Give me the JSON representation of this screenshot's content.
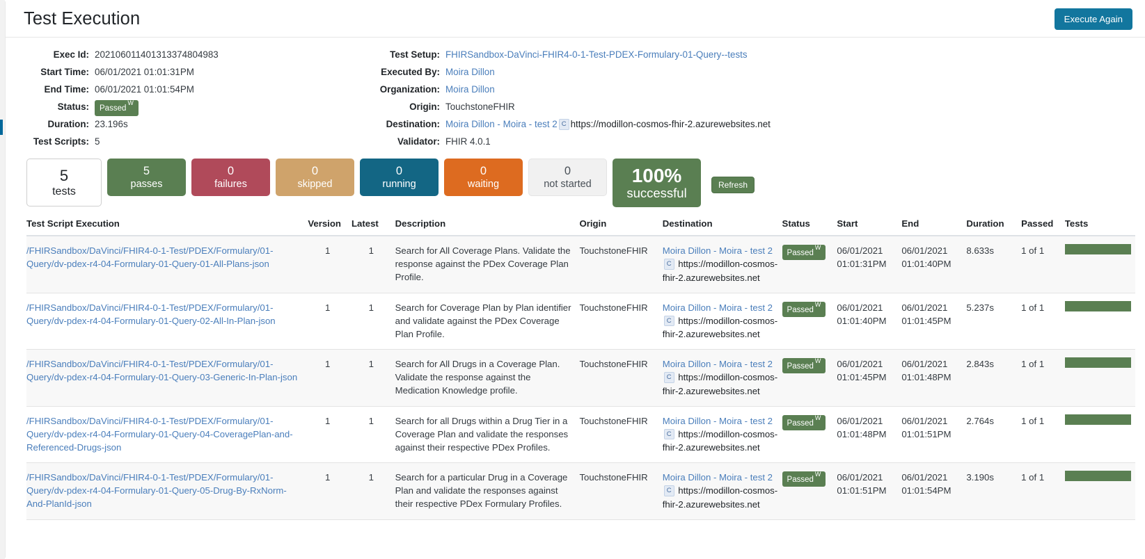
{
  "header": {
    "title": "Test Execution",
    "execute_again_label": "Execute Again"
  },
  "details": {
    "left": [
      {
        "label": "Exec Id:",
        "value": "20210601140131337480498 3"
      },
      {
        "label": "Start Time:",
        "value": "06/01/2021 01:01:31PM"
      },
      {
        "label": "End Time:",
        "value": "06/01/2021 01:01:54PM"
      },
      {
        "label": "Status:",
        "value": "Passed",
        "sup": "W"
      },
      {
        "label": "Duration:",
        "value": "23.196s"
      },
      {
        "label": "Test Scripts:",
        "value": "5"
      }
    ],
    "exec_id": "20210601140131337480498 3",
    "exec_id_text": "202106011401313374804983",
    "start_time": "06/01/2021 01:01:31PM",
    "end_time": "06/01/2021 01:01:54PM",
    "status_label": "Passed",
    "status_sup": "W",
    "duration": "23.196s",
    "test_scripts": "5",
    "labels": {
      "exec_id": "Exec Id:",
      "start_time": "Start Time:",
      "end_time": "End Time:",
      "status": "Status:",
      "duration": "Duration:",
      "test_scripts": "Test Scripts:",
      "test_setup": "Test Setup:",
      "executed_by": "Executed By:",
      "organization": "Organization:",
      "origin": "Origin:",
      "destination": "Destination:",
      "validator": "Validator:"
    },
    "test_setup": "FHIRSandbox-DaVinci-FHIR4-0-1-Test-PDEX-Formulary-01-Query--tests",
    "executed_by": "Moira Dillon",
    "organization": "Moira Dillon",
    "origin": "TouchstoneFHIR",
    "destination_link": "Moira Dillon - Moira - test 2",
    "destination_chip": "C",
    "destination_url": "https://modillon-cosmos-fhir-2.azurewebsites.net",
    "validator": "FHIR 4.0.1"
  },
  "stats": {
    "tests": {
      "num": "5",
      "cap": "tests"
    },
    "passes": {
      "num": "5",
      "cap": "passes",
      "color": "#5a7f52"
    },
    "failures": {
      "num": "0",
      "cap": "failures",
      "color": "#b04a5a"
    },
    "skipped": {
      "num": "0",
      "cap": "skipped",
      "color": "#cfa36b"
    },
    "running": {
      "num": "0",
      "cap": "running",
      "color": "#136684"
    },
    "waiting": {
      "num": "0",
      "cap": "waiting",
      "color": "#dd6b20"
    },
    "not_started": {
      "num": "0",
      "cap": "not started",
      "color": "#f1f1f1"
    },
    "percent": {
      "num": "100%",
      "cap": "successful",
      "color": "#5a7f52"
    },
    "refresh_label": "Refresh"
  },
  "table": {
    "columns": [
      "Test Script Execution",
      "Version",
      "Latest",
      "Description",
      "Origin",
      "Destination",
      "Status",
      "Start",
      "End",
      "Duration",
      "Passed",
      "Tests"
    ],
    "rows": [
      {
        "script": "/FHIRSandbox/DaVinci/FHIR4-0-1-Test/PDEX/Formulary/01-Query/dv-pdex-r4-04-Formulary-01-Query-01-All-Plans-json",
        "version": "1",
        "latest": "1",
        "description": "Search for All Coverage Plans. Validate the response against the PDex Coverage Plan Profile.",
        "origin": "TouchstoneFHIR",
        "destination_link": "Moira Dillon - Moira - test 2",
        "destination_chip": "C",
        "destination_url": "https://modillon-cosmos-fhir-2.azurewebsites.net",
        "status": "Passed",
        "status_sup": "W",
        "start_date": "06/01/2021",
        "start_time": "01:01:31PM",
        "end_date": "06/01/2021",
        "end_time": "01:01:40PM",
        "duration": "8.633s",
        "passed": "1 of 1",
        "bar_percent": 100
      },
      {
        "script": "/FHIRSandbox/DaVinci/FHIR4-0-1-Test/PDEX/Formulary/01-Query/dv-pdex-r4-04-Formulary-01-Query-02-All-In-Plan-json",
        "version": "1",
        "latest": "1",
        "description": "Search for Coverage Plan by Plan identifier and validate against the PDex Coverage Plan Profile.",
        "origin": "TouchstoneFHIR",
        "destination_link": "Moira Dillon - Moira - test 2",
        "destination_chip": "C",
        "destination_url": "https://modillon-cosmos-fhir-2.azurewebsites.net",
        "status": "Passed",
        "status_sup": "W",
        "start_date": "06/01/2021",
        "start_time": "01:01:40PM",
        "end_date": "06/01/2021",
        "end_time": "01:01:45PM",
        "duration": "5.237s",
        "passed": "1 of 1",
        "bar_percent": 100
      },
      {
        "script": "/FHIRSandbox/DaVinci/FHIR4-0-1-Test/PDEX/Formulary/01-Query/dv-pdex-r4-04-Formulary-01-Query-03-Generic-In-Plan-json",
        "version": "1",
        "latest": "1",
        "description": "Search for All Drugs in a Coverage Plan. Validate the response against the Medication Knowledge profile.",
        "origin": "TouchstoneFHIR",
        "destination_link": "Moira Dillon - Moira - test 2",
        "destination_chip": "C",
        "destination_url": "https://modillon-cosmos-fhir-2.azurewebsites.net",
        "status": "Passed",
        "status_sup": "W",
        "start_date": "06/01/2021",
        "start_time": "01:01:45PM",
        "end_date": "06/01/2021",
        "end_time": "01:01:48PM",
        "duration": "2.843s",
        "passed": "1 of 1",
        "bar_percent": 100
      },
      {
        "script": "/FHIRSandbox/DaVinci/FHIR4-0-1-Test/PDEX/Formulary/01-Query/dv-pdex-r4-04-Formulary-01-Query-04-CoveragePlan-and-Referenced-Drugs-json",
        "version": "1",
        "latest": "1",
        "description": "Search for all Drugs within a Drug Tier in a Coverage Plan and validate the responses against their respective PDex Profiles.",
        "origin": "TouchstoneFHIR",
        "destination_link": "Moira Dillon - Moira - test 2",
        "destination_chip": "C",
        "destination_url": "https://modillon-cosmos-fhir-2.azurewebsites.net",
        "status": "Passed",
        "status_sup": "W",
        "start_date": "06/01/2021",
        "start_time": "01:01:48PM",
        "end_date": "06/01/2021",
        "end_time": "01:01:51PM",
        "duration": "2.764s",
        "passed": "1 of 1",
        "bar_percent": 100
      },
      {
        "script": "/FHIRSandbox/DaVinci/FHIR4-0-1-Test/PDEX/Formulary/01-Query/dv-pdex-r4-04-Formulary-01-Query-05-Drug-By-RxNorm-And-PlanId-json",
        "version": "1",
        "latest": "1",
        "description": "Search for a particular Drug in a Coverage Plan and validate the responses against their respective PDex Formulary Profiles.",
        "origin": "TouchstoneFHIR",
        "destination_link": "Moira Dillon - Moira - test 2",
        "destination_chip": "C",
        "destination_url": "https://modillon-cosmos-fhir-2.azurewebsites.net",
        "status": "Passed",
        "status_sup": "W",
        "start_date": "06/01/2021",
        "start_time": "01:01:51PM",
        "end_date": "06/01/2021",
        "end_time": "01:01:54PM",
        "duration": "3.190s",
        "passed": "1 of 1",
        "bar_percent": 100
      }
    ]
  }
}
